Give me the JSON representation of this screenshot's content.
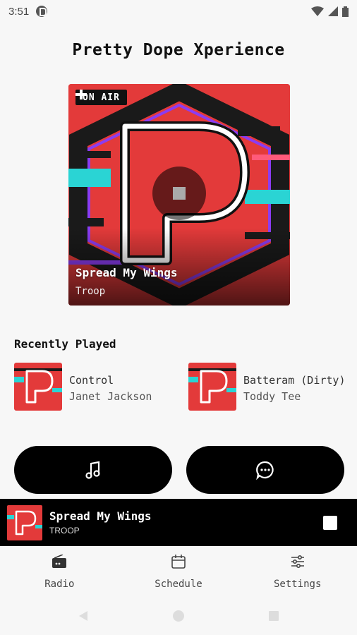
{
  "status": {
    "time": "3:51"
  },
  "app": {
    "title": "Pretty Dope Xperience"
  },
  "now_playing": {
    "on_air_label": "ON AIR",
    "title": "Spread My Wings",
    "artist": "Troop"
  },
  "recent": {
    "title": "Recently Played",
    "items": [
      {
        "title": "Control",
        "artist": "Janet Jackson"
      },
      {
        "title": "Batteram (Dirty)",
        "artist": "Toddy Tee"
      }
    ]
  },
  "actions": {
    "request_icon": "music-note-icon",
    "chat_icon": "chat-bubble-icon"
  },
  "mini_player": {
    "title": "Spread My Wings",
    "artist": "TROOP"
  },
  "nav": {
    "items": [
      {
        "label": "Radio",
        "icon": "radio-icon"
      },
      {
        "label": "Schedule",
        "icon": "calendar-icon"
      },
      {
        "label": "Settings",
        "icon": "sliders-icon"
      }
    ]
  },
  "colors": {
    "brand_red": "#e33a3a",
    "accent_cyan": "#2ad4d4",
    "accent_purple": "#8b3cf2"
  }
}
